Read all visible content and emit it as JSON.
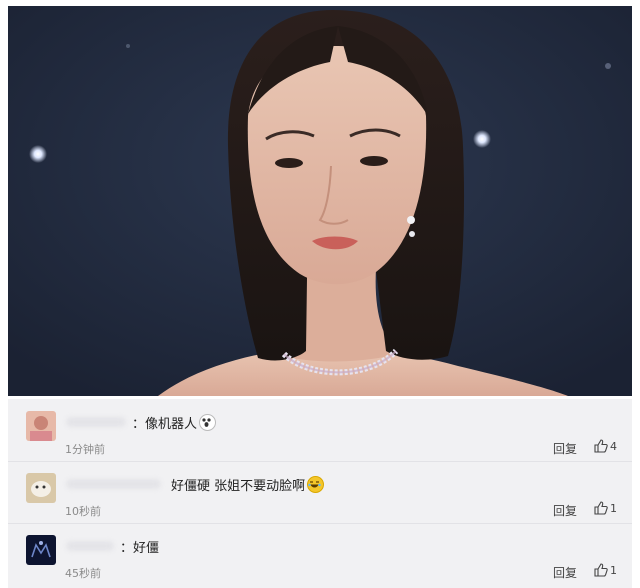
{
  "comments": [
    {
      "text": "：像机器人",
      "emoji": "shock-emoji",
      "time": "1分钟前",
      "reply_label": "回复",
      "likes": "4"
    },
    {
      "text": "好僵硬 张姐不要动脸啊",
      "emoji": "laughing-emoji",
      "time": "10秒前",
      "reply_label": "回复",
      "likes": "1"
    },
    {
      "text": "：好僵",
      "emoji": "",
      "time": "45秒前",
      "reply_label": "回复",
      "likes": "1"
    }
  ],
  "colors": {
    "photo_background": "#222c3e",
    "comment_background": "#f1f1f3",
    "text": "#222222",
    "meta_text": "#8a8a8a"
  },
  "icons": {
    "like": "thumbs-up-icon"
  }
}
